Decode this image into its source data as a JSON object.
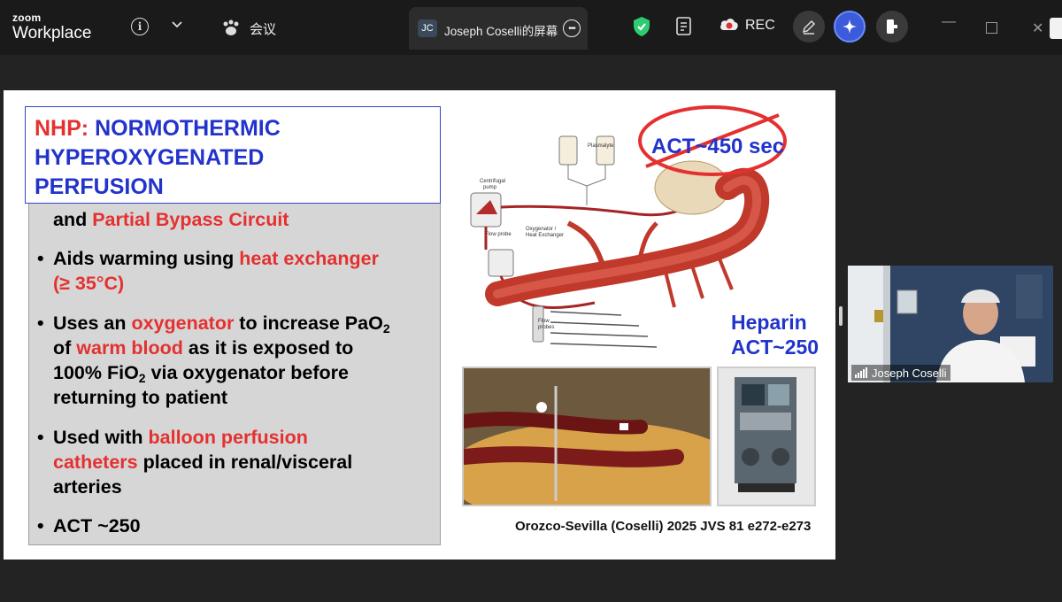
{
  "app": {
    "logo_line1": "zoom",
    "logo_line2": "Workplace",
    "meeting_label": "会议",
    "share_badge": "JC",
    "share_title": "Joseph Coselli的屏幕",
    "rec_label": "REC"
  },
  "colors": {
    "topbar": "#1a1a1a",
    "background": "#232323",
    "accent_blue": "#3b5bdb",
    "shield_green": "#2ecc71",
    "rec_red": "#e03131",
    "slide_blue": "#2233cc",
    "slide_red": "#e53030"
  },
  "icons": [
    "info-icon",
    "chevron-down-icon",
    "paw-icon",
    "more-icon",
    "shield-check-icon",
    "notes-icon",
    "cloud-record-icon",
    "pen-icon",
    "ai-sparkle-icon",
    "exit-share-icon",
    "minimize-icon",
    "maximize-icon",
    "close-icon",
    "signal-icon"
  ],
  "slide": {
    "title_red": "NHP:",
    "title_blue_1": "NORMOTHERMIC",
    "title_blue_2": "HYPEROXYGENATED",
    "title_blue_3": "PERFUSION",
    "b1_a": "and ",
    "b1_red": "Partial Bypass Circuit",
    "b2_a": "Aids warming using ",
    "b2_red": "heat exchanger",
    "b2_red2": "(≥ 35°C)",
    "b3_a": "Uses an ",
    "b3_red": "oxygenator",
    "b3_b": " to increase PaO",
    "b3_sub": "2",
    "b3_c": "of ",
    "b3_red2": "warm blood",
    "b3_d": " as it is exposed to",
    "b3_e": "100% FiO",
    "b3_sub2": "2",
    "b3_f": " via oxygenator before",
    "b3_g": "returning to patient",
    "b4_a": "Used with ",
    "b4_red": "balloon perfusion",
    "b4_red2": "catheters",
    "b4_b": "   placed in renal/visceral",
    "b4_c": "arteries",
    "b5": "ACT ~250",
    "bullet_char": "•",
    "act_crossed": "ACT~450 sec",
    "heparin_1": "Heparin",
    "heparin_2": "ACT~250",
    "diag_plasmalyte": "Plasmalyte",
    "diag_centrifugal_1": "Centrifugal",
    "diag_centrifugal_2": "pump",
    "diag_flow_probe": "Flow probe",
    "diag_oxy_1": "Oxygenator /",
    "diag_oxy_2": "Heat Exchanger",
    "diag_flow_probes_1": "Flow",
    "diag_flow_probes_2": "probes",
    "citation": "Orozco-Sevilla (Coselli) 2025 JVS 81 e272-e273"
  },
  "video": {
    "participant_name": "Joseph Coselli"
  }
}
